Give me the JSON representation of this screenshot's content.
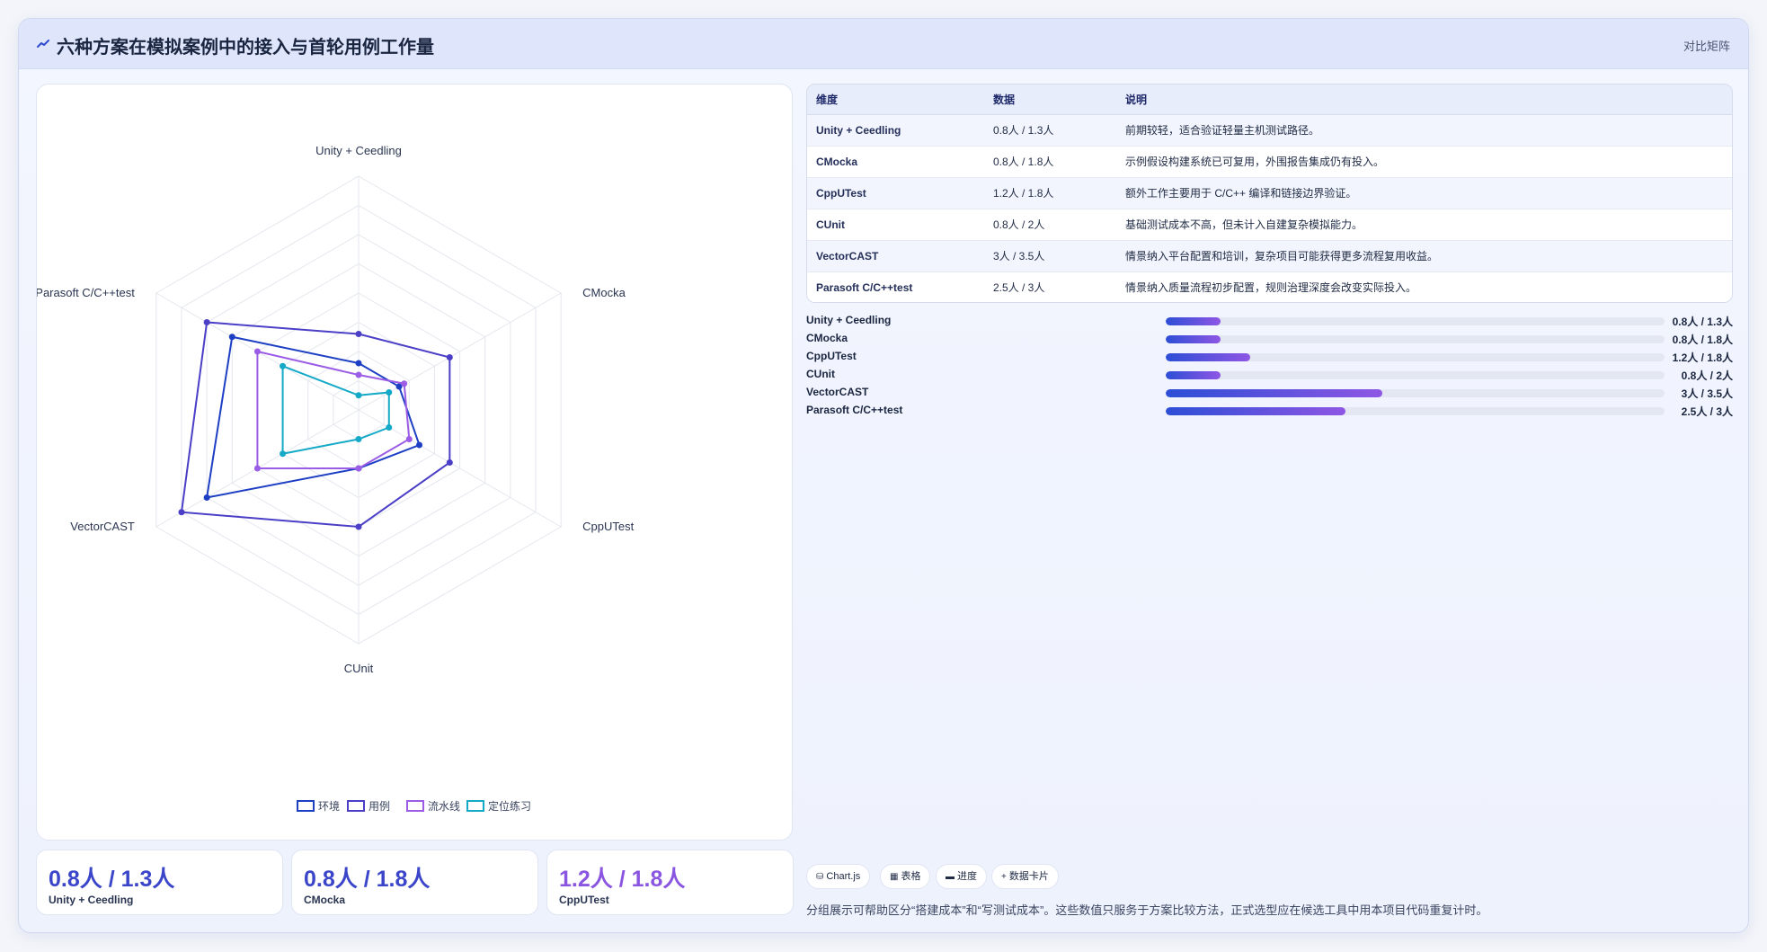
{
  "header": {
    "icon": "chart-line-icon",
    "title": "六种方案在模拟案例中的接入与首轮用例工作量",
    "right_label": "对比矩阵"
  },
  "chart_data": {
    "type": "radar",
    "categories": [
      "Unity + Ceedling",
      "CMocka",
      "CppUTest",
      "CUnit",
      "VectorCAST",
      "Parasoft C/C++test"
    ],
    "series": [
      {
        "name": "环境",
        "values": [
          0.8,
          0.8,
          1.2,
          1.0,
          3.0,
          2.5
        ],
        "color": "#1d3fc4"
      },
      {
        "name": "用例",
        "values": [
          1.3,
          1.8,
          1.8,
          2.0,
          3.5,
          3.0
        ],
        "color": "#4b3fc7"
      },
      {
        "name": "流水线",
        "values": [
          0.6,
          0.9,
          1.0,
          1.0,
          2.0,
          2.0
        ],
        "color": "#9b5de5"
      },
      {
        "name": "定位练习",
        "values": [
          0.25,
          0.6,
          0.6,
          0.5,
          1.5,
          1.5
        ],
        "color": "#15a9c8"
      }
    ],
    "rmax": 4,
    "grid_levels": 8,
    "legend": "bottom"
  },
  "table": {
    "headers": [
      "维度",
      "数据",
      "说明"
    ],
    "rows": [
      [
        "Unity + Ceedling",
        "0.8人 / 1.3人",
        "前期较轻，适合验证轻量主机测试路径。"
      ],
      [
        "CMocka",
        "0.8人 / 1.8人",
        "示例假设构建系统已可复用，外围报告集成仍有投入。"
      ],
      [
        "CppUTest",
        "1.2人 / 1.8人",
        "额外工作主要用于 C/C++ 编译和链接边界验证。"
      ],
      [
        "CUnit",
        "0.8人 / 2人",
        "基础测试成本不高，但未计入自建复杂模拟能力。"
      ],
      [
        "VectorCAST",
        "3人 / 3.5人",
        "情景纳入平台配置和培训，复杂项目可能获得更多流程复用收益。"
      ],
      [
        "Parasoft C/C++test",
        "2.5人 / 3人",
        "情景纳入质量流程初步配置，规则治理深度会改变实际投入。"
      ]
    ]
  },
  "progress": [
    {
      "name": "Unity + Ceedling",
      "value": "0.8人 / 1.3人",
      "fraction": 0.11
    },
    {
      "name": "CMocka",
      "value": "0.8人 / 1.8人",
      "fraction": 0.11
    },
    {
      "name": "CppUTest",
      "value": "1.2人 / 1.8人",
      "fraction": 0.17
    },
    {
      "name": "CUnit",
      "value": "0.8人 / 2人",
      "fraction": 0.11
    },
    {
      "name": "VectorCAST",
      "value": "3人 / 3.5人",
      "fraction": 0.435
    },
    {
      "name": "Parasoft C/C++test",
      "value": "2.5人 / 3人",
      "fraction": 0.36
    }
  ],
  "stats": [
    {
      "value": "0.8人 / 1.3人",
      "label": "Unity + Ceedling",
      "color": "#3a45c9"
    },
    {
      "value": "0.8人 / 1.8人",
      "label": "CMocka",
      "color": "#3a45c9"
    },
    {
      "value": "1.2人 / 1.8人",
      "label": "CppUTest",
      "color": "#8a55e0"
    }
  ],
  "tags": [
    {
      "icon": "⛁",
      "icon_name": "database-icon",
      "label": "Chart.js"
    },
    {
      "icon": "▦",
      "icon_name": "table-icon",
      "label": "表格"
    },
    {
      "icon": "▬",
      "icon_name": "progress-icon",
      "label": "进度"
    },
    {
      "icon": "+",
      "icon_name": "plus-icon",
      "label": "数据卡片"
    }
  ],
  "note": "分组展示可帮助区分“搭建成本”和“写测试成本”。这些数值只服务于方案比较方法，正式选型应在候选工具中用本项目代码重复计时。"
}
